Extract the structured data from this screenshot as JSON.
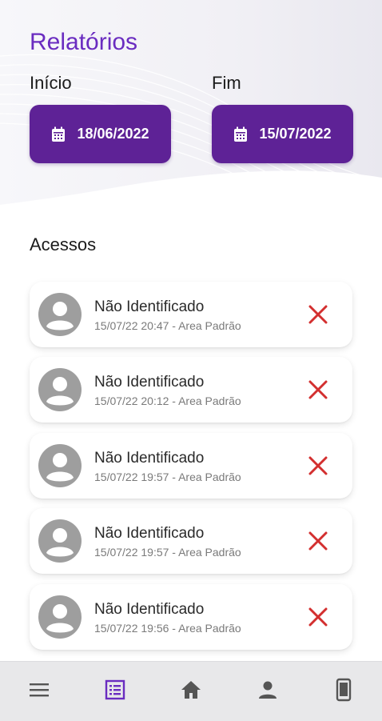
{
  "header": {
    "title": "Relatórios",
    "start": {
      "label": "Início",
      "date": "18/06/2022"
    },
    "end": {
      "label": "Fim",
      "date": "15/07/2022"
    }
  },
  "accesses": {
    "section_title": "Acessos",
    "items": [
      {
        "name": "Não Identificado",
        "detail": "15/07/22 20:47 - Area Padrão"
      },
      {
        "name": "Não Identificado",
        "detail": "15/07/22 20:12 - Area Padrão"
      },
      {
        "name": "Não Identificado",
        "detail": "15/07/22 19:57 - Area Padrão"
      },
      {
        "name": "Não Identificado",
        "detail": "15/07/22 19:57 - Area Padrão"
      },
      {
        "name": "Não Identificado",
        "detail": "15/07/22 19:56 - Area Padrão"
      }
    ]
  },
  "bottom_nav": {
    "items": [
      {
        "icon": "menu-icon",
        "active": false
      },
      {
        "icon": "reports-icon",
        "active": true
      },
      {
        "icon": "home-icon",
        "active": false
      },
      {
        "icon": "user-icon",
        "active": false
      },
      {
        "icon": "smartphone-icon",
        "active": false
      }
    ]
  },
  "colors": {
    "accent": "#6a2cc0",
    "button": "#5e2296",
    "delete": "#d32f2f",
    "avatar": "#9e9e9e",
    "nav_inactive": "#555555"
  }
}
